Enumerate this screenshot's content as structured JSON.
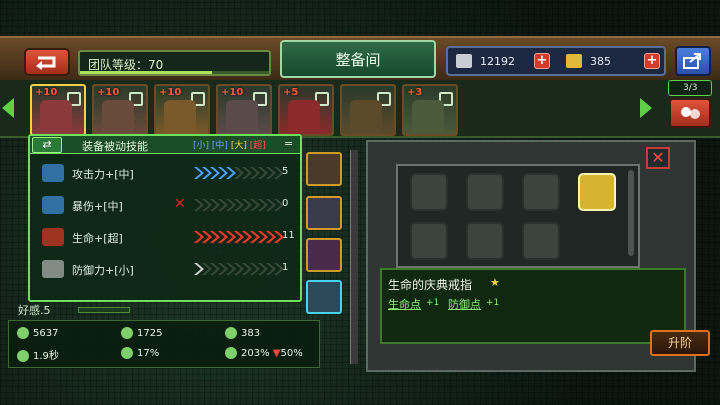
{
  "header": {
    "team_level": "团队等级：70",
    "team_level_progress": 0.7,
    "title": "整备间",
    "currency_a": "12192",
    "currency_b": "385",
    "slot_count": "3/3"
  },
  "roster": [
    {
      "level": "+10",
      "color": "#8a3a3a"
    },
    {
      "level": "+10",
      "color": "#6a4a3a"
    },
    {
      "level": "+10",
      "color": "#7a5a2a"
    },
    {
      "level": "+10",
      "color": "#5a4a4a"
    },
    {
      "level": "+5",
      "color": "#8a2a2a"
    },
    {
      "level": "",
      "color": "#5a4a2a"
    },
    {
      "level": "+3",
      "color": "#4a5a3a"
    }
  ],
  "skills": {
    "title": "装备被动技能",
    "levels": [
      "[小]",
      "[中]",
      "[大]",
      "[超]"
    ],
    "rows": [
      {
        "name": "攻击力+[中]",
        "count": "5",
        "chevrons": 5,
        "color": "#4aa0ff"
      },
      {
        "name": "暴伤+[中]",
        "count": "0",
        "chevrons": 0,
        "color": "#4aa0ff"
      },
      {
        "name": "生命+[超]",
        "count": "11",
        "chevrons": 11,
        "color": "#ff3a2a"
      },
      {
        "name": "防御力+[小]",
        "count": "1",
        "chevrons": 1,
        "color": "#cfcfcf"
      }
    ]
  },
  "stats": {
    "favor": "好感.5",
    "hp": "5637",
    "attack": "1725",
    "defense": "383",
    "speed": "1.9秒",
    "crit": "17%",
    "crit_dmg": "203%",
    "decrease": "50%"
  },
  "detail": {
    "item_name": "生命的庆典戒指",
    "stat_a": "生命点",
    "stat_a_suffix": "+1",
    "stat_b": "防御点",
    "stat_b_suffix": "+1",
    "upgrade": "升阶"
  }
}
